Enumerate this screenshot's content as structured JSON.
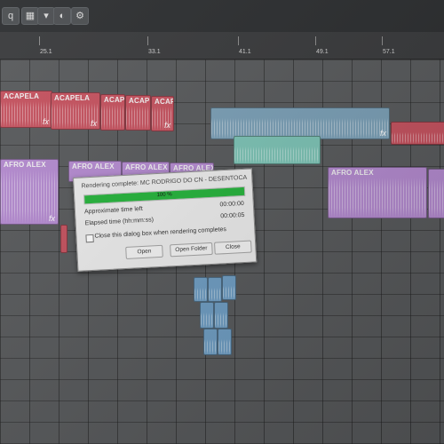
{
  "toolbar": {
    "icons": [
      "q-letter-icon",
      "grid-icon",
      "dropdown-arrow-icon",
      "snap-icon",
      "settings-icon"
    ],
    "first_label": "q"
  },
  "ruler": {
    "labels": [
      "25.1",
      "33.1",
      "41.1",
      "49.1",
      "57.1"
    ]
  },
  "clips": {
    "acapela_label": "ACAPELA",
    "afro_label": "AFRO ALEX",
    "fx_label": "fx"
  },
  "render_dialog": {
    "title": "Rendering complete: MC RODRIGO DO CN - DESENTOCA",
    "progress_text": "100 %",
    "progress_fraction": 1.0,
    "time_left_label": "Approximate time left",
    "time_left_value": "00:00:00",
    "elapsed_label": "Elapsed time (hh:mm:ss)",
    "elapsed_value": "00:00:05",
    "checkbox_label": "Close this dialog box when rendering completes",
    "checkbox_checked": false,
    "open_button": "Open",
    "open_folder_button": "Open Folder",
    "close_button": "Close"
  },
  "colors": {
    "progress": "#24b33a",
    "acapela_clip": "#c5515e",
    "afro_clip": "#b48ad0",
    "blue_clip": "#7a9fb6",
    "teal_clip": "#7cc3b5"
  }
}
